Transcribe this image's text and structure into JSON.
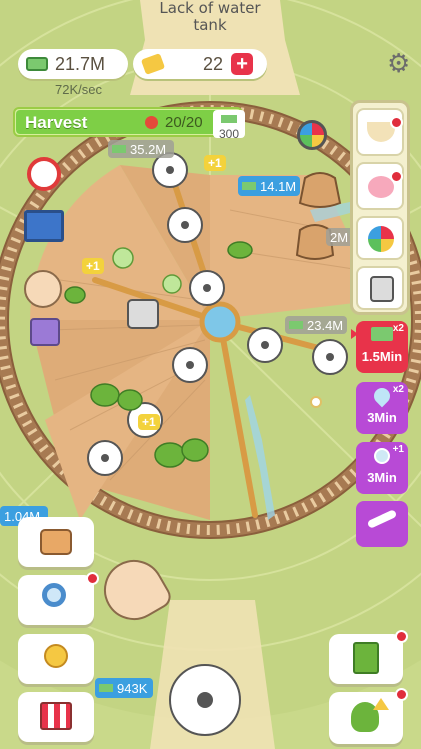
{
  "hud": {
    "money": "21.7M",
    "rate": "72K/sec",
    "tickets": "22",
    "tank_alert": "Lack of water tank"
  },
  "harvest": {
    "label": "Harvest",
    "count": "20/20",
    "reward": "300",
    "fill": 1.0
  },
  "field_labels": {
    "chip_top": "35.2M",
    "chip_right": "14.1M",
    "chip_right2": "2M",
    "chip_mid": "23.4M",
    "chip_left": "1.04M",
    "chip_bottom": "943K",
    "plus_1": "+1",
    "plus_2": "+1",
    "plus_3": "+1"
  },
  "boosts": [
    {
      "label": "1.5Min",
      "mult": "x2",
      "color": "#e8334a"
    },
    {
      "label": "3Min",
      "mult": "x2",
      "color": "#b84ad6"
    },
    {
      "label": "3Min",
      "mult": "+1",
      "color": "#b84ad6"
    }
  ],
  "colors": {
    "grass": "#c9d98a",
    "soil": "#e5b583",
    "rail": "#a77a52",
    "accent_red": "#e8334a",
    "accent_purple": "#b84ad6"
  }
}
